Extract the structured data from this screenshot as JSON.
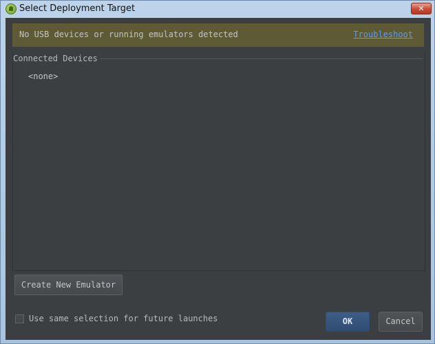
{
  "window": {
    "title": "Select Deployment Target",
    "close_glyph": "✕"
  },
  "warning": {
    "text": "No USB devices or running emulators detected",
    "link": "Troubleshoot"
  },
  "devices": {
    "header": "Connected Devices",
    "items": [
      "<none>"
    ]
  },
  "actions": {
    "create_emulator": "Create New Emulator",
    "remember_label": "Use same selection for future launches",
    "remember_checked": false,
    "ok": "OK",
    "cancel": "Cancel"
  },
  "colors": {
    "background": "#3c3f41",
    "warning_bg": "#5e5a36",
    "link": "#589df6",
    "primary_button": "#365780"
  }
}
